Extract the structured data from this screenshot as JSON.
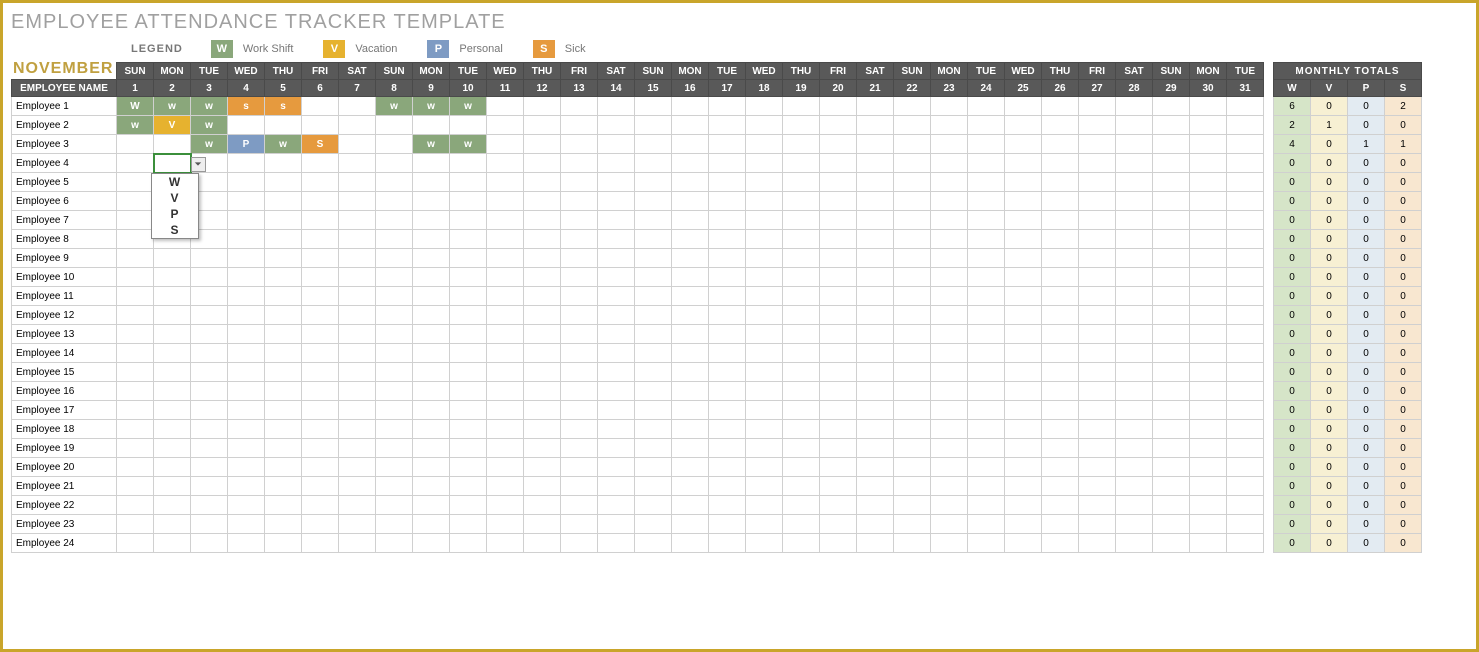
{
  "title": "EMPLOYEE ATTENDANCE TRACKER TEMPLATE",
  "legend": {
    "label": "LEGEND",
    "items": [
      {
        "code": "W",
        "label": "Work Shift",
        "class": "w-bg"
      },
      {
        "code": "V",
        "label": "Vacation",
        "class": "v-bg"
      },
      {
        "code": "P",
        "label": "Personal",
        "class": "p-bg"
      },
      {
        "code": "S",
        "label": "Sick",
        "class": "s-bg"
      }
    ]
  },
  "month": "NOVEMBER",
  "emp_header": "EMPLOYEE NAME",
  "totals_header": "MONTHLY TOTALS",
  "totals_cols": [
    "W",
    "V",
    "P",
    "S"
  ],
  "dow": [
    "SUN",
    "MON",
    "TUE",
    "WED",
    "THU",
    "FRI",
    "SAT",
    "SUN",
    "MON",
    "TUE",
    "WED",
    "THU",
    "FRI",
    "SAT",
    "SUN",
    "MON",
    "TUE",
    "WED",
    "THU",
    "FRI",
    "SAT",
    "SUN",
    "MON",
    "TUE",
    "WED",
    "THU",
    "FRI",
    "SAT",
    "SUN",
    "MON",
    "TUE"
  ],
  "dates": [
    "1",
    "2",
    "3",
    "4",
    "5",
    "6",
    "7",
    "8",
    "9",
    "10",
    "11",
    "12",
    "13",
    "14",
    "15",
    "16",
    "17",
    "18",
    "19",
    "20",
    "21",
    "22",
    "23",
    "24",
    "25",
    "26",
    "27",
    "28",
    "29",
    "30",
    "31"
  ],
  "dropdown": {
    "options": [
      "W",
      "V",
      "P",
      "S"
    ],
    "open_on_row": 3,
    "open_on_col": 1
  },
  "colors": {
    "W": "w-bg",
    "w": "w-bg",
    "V": "v-bg",
    "P": "p-bg",
    "S": "s-bg",
    "s": "s-bg"
  },
  "rows": [
    {
      "name": "Employee 1",
      "cells": [
        "W",
        "w",
        "w",
        "s",
        "s",
        "",
        "",
        "w",
        "w",
        "w",
        "",
        "",
        "",
        "",
        "",
        "",
        "",
        "",
        "",
        "",
        "",
        "",
        "",
        "",
        "",
        "",
        "",
        "",
        "",
        "",
        ""
      ],
      "totals": [
        "6",
        "0",
        "0",
        "2"
      ]
    },
    {
      "name": "Employee 2",
      "cells": [
        "w",
        "V",
        "w",
        "",
        "",
        "",
        "",
        "",
        "",
        "",
        "",
        "",
        "",
        "",
        "",
        "",
        "",
        "",
        "",
        "",
        "",
        "",
        "",
        "",
        "",
        "",
        "",
        "",
        "",
        "",
        ""
      ],
      "totals": [
        "2",
        "1",
        "0",
        "0"
      ]
    },
    {
      "name": "Employee 3",
      "cells": [
        "",
        "",
        "w",
        "P",
        "w",
        "S",
        "",
        "",
        "w",
        "w",
        "",
        "",
        "",
        "",
        "",
        "",
        "",
        "",
        "",
        "",
        "",
        "",
        "",
        "",
        "",
        "",
        "",
        "",
        "",
        "",
        ""
      ],
      "totals": [
        "4",
        "0",
        "1",
        "1"
      ]
    },
    {
      "name": "Employee 4",
      "cells": [
        "",
        "",
        "",
        "",
        "",
        "",
        "",
        "",
        "",
        "",
        "",
        "",
        "",
        "",
        "",
        "",
        "",
        "",
        "",
        "",
        "",
        "",
        "",
        "",
        "",
        "",
        "",
        "",
        "",
        "",
        ""
      ],
      "totals": [
        "0",
        "0",
        "0",
        "0"
      ]
    },
    {
      "name": "Employee 5",
      "cells": [
        "",
        "",
        "",
        "",
        "",
        "",
        "",
        "",
        "",
        "",
        "",
        "",
        "",
        "",
        "",
        "",
        "",
        "",
        "",
        "",
        "",
        "",
        "",
        "",
        "",
        "",
        "",
        "",
        "",
        "",
        ""
      ],
      "totals": [
        "0",
        "0",
        "0",
        "0"
      ]
    },
    {
      "name": "Employee 6",
      "cells": [
        "",
        "",
        "",
        "",
        "",
        "",
        "",
        "",
        "",
        "",
        "",
        "",
        "",
        "",
        "",
        "",
        "",
        "",
        "",
        "",
        "",
        "",
        "",
        "",
        "",
        "",
        "",
        "",
        "",
        "",
        ""
      ],
      "totals": [
        "0",
        "0",
        "0",
        "0"
      ]
    },
    {
      "name": "Employee 7",
      "cells": [
        "",
        "",
        "",
        "",
        "",
        "",
        "",
        "",
        "",
        "",
        "",
        "",
        "",
        "",
        "",
        "",
        "",
        "",
        "",
        "",
        "",
        "",
        "",
        "",
        "",
        "",
        "",
        "",
        "",
        "",
        ""
      ],
      "totals": [
        "0",
        "0",
        "0",
        "0"
      ]
    },
    {
      "name": "Employee 8",
      "cells": [
        "",
        "",
        "",
        "",
        "",
        "",
        "",
        "",
        "",
        "",
        "",
        "",
        "",
        "",
        "",
        "",
        "",
        "",
        "",
        "",
        "",
        "",
        "",
        "",
        "",
        "",
        "",
        "",
        "",
        "",
        ""
      ],
      "totals": [
        "0",
        "0",
        "0",
        "0"
      ]
    },
    {
      "name": "Employee 9",
      "cells": [
        "",
        "",
        "",
        "",
        "",
        "",
        "",
        "",
        "",
        "",
        "",
        "",
        "",
        "",
        "",
        "",
        "",
        "",
        "",
        "",
        "",
        "",
        "",
        "",
        "",
        "",
        "",
        "",
        "",
        "",
        ""
      ],
      "totals": [
        "0",
        "0",
        "0",
        "0"
      ]
    },
    {
      "name": "Employee 10",
      "cells": [
        "",
        "",
        "",
        "",
        "",
        "",
        "",
        "",
        "",
        "",
        "",
        "",
        "",
        "",
        "",
        "",
        "",
        "",
        "",
        "",
        "",
        "",
        "",
        "",
        "",
        "",
        "",
        "",
        "",
        "",
        ""
      ],
      "totals": [
        "0",
        "0",
        "0",
        "0"
      ]
    },
    {
      "name": "Employee 11",
      "cells": [
        "",
        "",
        "",
        "",
        "",
        "",
        "",
        "",
        "",
        "",
        "",
        "",
        "",
        "",
        "",
        "",
        "",
        "",
        "",
        "",
        "",
        "",
        "",
        "",
        "",
        "",
        "",
        "",
        "",
        "",
        ""
      ],
      "totals": [
        "0",
        "0",
        "0",
        "0"
      ]
    },
    {
      "name": "Employee 12",
      "cells": [
        "",
        "",
        "",
        "",
        "",
        "",
        "",
        "",
        "",
        "",
        "",
        "",
        "",
        "",
        "",
        "",
        "",
        "",
        "",
        "",
        "",
        "",
        "",
        "",
        "",
        "",
        "",
        "",
        "",
        "",
        ""
      ],
      "totals": [
        "0",
        "0",
        "0",
        "0"
      ]
    },
    {
      "name": "Employee 13",
      "cells": [
        "",
        "",
        "",
        "",
        "",
        "",
        "",
        "",
        "",
        "",
        "",
        "",
        "",
        "",
        "",
        "",
        "",
        "",
        "",
        "",
        "",
        "",
        "",
        "",
        "",
        "",
        "",
        "",
        "",
        "",
        ""
      ],
      "totals": [
        "0",
        "0",
        "0",
        "0"
      ]
    },
    {
      "name": "Employee 14",
      "cells": [
        "",
        "",
        "",
        "",
        "",
        "",
        "",
        "",
        "",
        "",
        "",
        "",
        "",
        "",
        "",
        "",
        "",
        "",
        "",
        "",
        "",
        "",
        "",
        "",
        "",
        "",
        "",
        "",
        "",
        "",
        ""
      ],
      "totals": [
        "0",
        "0",
        "0",
        "0"
      ]
    },
    {
      "name": "Employee 15",
      "cells": [
        "",
        "",
        "",
        "",
        "",
        "",
        "",
        "",
        "",
        "",
        "",
        "",
        "",
        "",
        "",
        "",
        "",
        "",
        "",
        "",
        "",
        "",
        "",
        "",
        "",
        "",
        "",
        "",
        "",
        "",
        ""
      ],
      "totals": [
        "0",
        "0",
        "0",
        "0"
      ]
    },
    {
      "name": "Employee 16",
      "cells": [
        "",
        "",
        "",
        "",
        "",
        "",
        "",
        "",
        "",
        "",
        "",
        "",
        "",
        "",
        "",
        "",
        "",
        "",
        "",
        "",
        "",
        "",
        "",
        "",
        "",
        "",
        "",
        "",
        "",
        "",
        ""
      ],
      "totals": [
        "0",
        "0",
        "0",
        "0"
      ]
    },
    {
      "name": "Employee 17",
      "cells": [
        "",
        "",
        "",
        "",
        "",
        "",
        "",
        "",
        "",
        "",
        "",
        "",
        "",
        "",
        "",
        "",
        "",
        "",
        "",
        "",
        "",
        "",
        "",
        "",
        "",
        "",
        "",
        "",
        "",
        "",
        ""
      ],
      "totals": [
        "0",
        "0",
        "0",
        "0"
      ]
    },
    {
      "name": "Employee 18",
      "cells": [
        "",
        "",
        "",
        "",
        "",
        "",
        "",
        "",
        "",
        "",
        "",
        "",
        "",
        "",
        "",
        "",
        "",
        "",
        "",
        "",
        "",
        "",
        "",
        "",
        "",
        "",
        "",
        "",
        "",
        "",
        ""
      ],
      "totals": [
        "0",
        "0",
        "0",
        "0"
      ]
    },
    {
      "name": "Employee 19",
      "cells": [
        "",
        "",
        "",
        "",
        "",
        "",
        "",
        "",
        "",
        "",
        "",
        "",
        "",
        "",
        "",
        "",
        "",
        "",
        "",
        "",
        "",
        "",
        "",
        "",
        "",
        "",
        "",
        "",
        "",
        "",
        ""
      ],
      "totals": [
        "0",
        "0",
        "0",
        "0"
      ]
    },
    {
      "name": "Employee 20",
      "cells": [
        "",
        "",
        "",
        "",
        "",
        "",
        "",
        "",
        "",
        "",
        "",
        "",
        "",
        "",
        "",
        "",
        "",
        "",
        "",
        "",
        "",
        "",
        "",
        "",
        "",
        "",
        "",
        "",
        "",
        "",
        ""
      ],
      "totals": [
        "0",
        "0",
        "0",
        "0"
      ]
    },
    {
      "name": "Employee 21",
      "cells": [
        "",
        "",
        "",
        "",
        "",
        "",
        "",
        "",
        "",
        "",
        "",
        "",
        "",
        "",
        "",
        "",
        "",
        "",
        "",
        "",
        "",
        "",
        "",
        "",
        "",
        "",
        "",
        "",
        "",
        "",
        ""
      ],
      "totals": [
        "0",
        "0",
        "0",
        "0"
      ]
    },
    {
      "name": "Employee 22",
      "cells": [
        "",
        "",
        "",
        "",
        "",
        "",
        "",
        "",
        "",
        "",
        "",
        "",
        "",
        "",
        "",
        "",
        "",
        "",
        "",
        "",
        "",
        "",
        "",
        "",
        "",
        "",
        "",
        "",
        "",
        "",
        ""
      ],
      "totals": [
        "0",
        "0",
        "0",
        "0"
      ]
    },
    {
      "name": "Employee 23",
      "cells": [
        "",
        "",
        "",
        "",
        "",
        "",
        "",
        "",
        "",
        "",
        "",
        "",
        "",
        "",
        "",
        "",
        "",
        "",
        "",
        "",
        "",
        "",
        "",
        "",
        "",
        "",
        "",
        "",
        "",
        "",
        ""
      ],
      "totals": [
        "0",
        "0",
        "0",
        "0"
      ]
    },
    {
      "name": "Employee 24",
      "cells": [
        "",
        "",
        "",
        "",
        "",
        "",
        "",
        "",
        "",
        "",
        "",
        "",
        "",
        "",
        "",
        "",
        "",
        "",
        "",
        "",
        "",
        "",
        "",
        "",
        "",
        "",
        "",
        "",
        "",
        "",
        ""
      ],
      "totals": [
        "0",
        "0",
        "0",
        "0"
      ]
    }
  ]
}
